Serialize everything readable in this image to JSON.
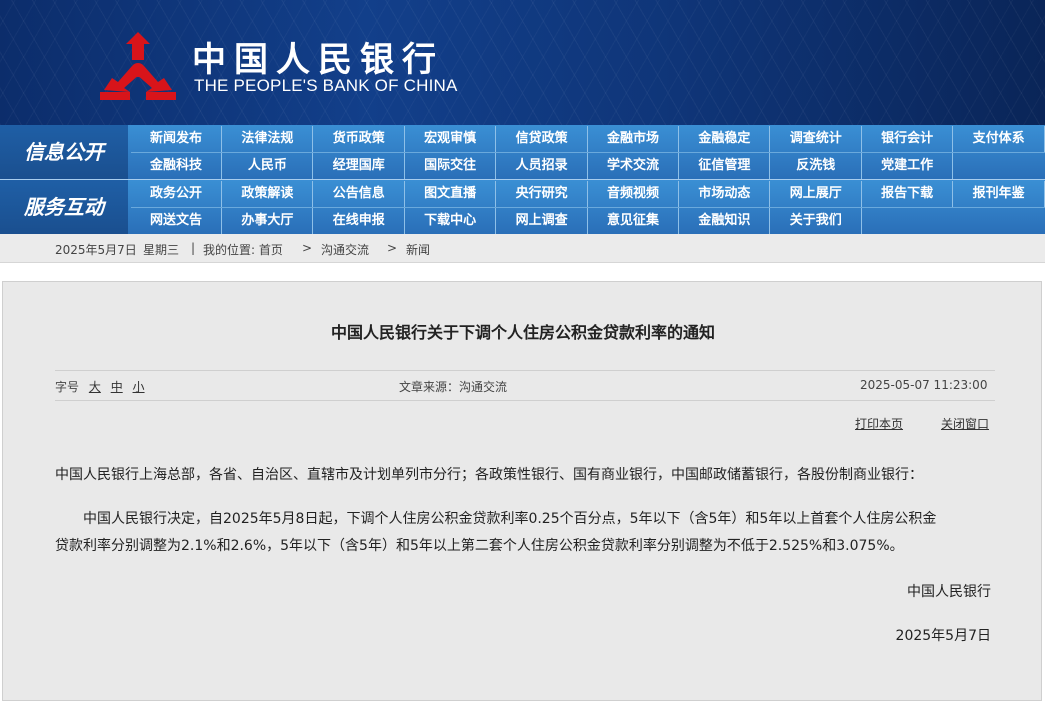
{
  "header": {
    "logo_cn": "中国人民银行",
    "logo_en": "THE PEOPLE'S BANK OF CHINA",
    "logo_icon": "pboc-emblem-icon",
    "brand_color": "#123f8a",
    "logo_red": "#d8141a"
  },
  "nav": {
    "section1_label": "信息公开",
    "section1_row1": [
      "新闻发布",
      "法律法规",
      "货币政策",
      "宏观审慎",
      "信贷政策",
      "金融市场",
      "金融稳定",
      "调查统计",
      "银行会计",
      "支付体系"
    ],
    "section1_row2": [
      "金融科技",
      "人民币",
      "经理国库",
      "国际交往",
      "人员招录",
      "学术交流",
      "征信管理",
      "反洗钱",
      "党建工作"
    ],
    "section2_label": "服务互动",
    "section2_row1": [
      "政务公开",
      "政策解读",
      "公告信息",
      "图文直播",
      "央行研究",
      "音频视频",
      "市场动态",
      "网上展厅",
      "报告下载",
      "报刊年鉴"
    ],
    "section2_row2": [
      "网送文告",
      "办事大厅",
      "在线申报",
      "下载中心",
      "网上调查",
      "意见征集",
      "金融知识",
      "关于我们"
    ]
  },
  "breadcrumb": {
    "date": "2025年5月7日",
    "weekday": "星期三",
    "sep": "|",
    "location_label": "我的位置: 首页",
    "arrow": ">",
    "level2": "沟通交流",
    "level3": "新闻"
  },
  "article": {
    "title": "中国人民银行关于下调个人住房公积金贷款利率的通知",
    "font_label": "字号",
    "font_large": "大",
    "font_medium": "中",
    "font_small": "小",
    "source": "文章来源：沟通交流",
    "timestamp": "2025-05-07 11:23:00",
    "print": "打印本页",
    "close": "关闭窗口",
    "salutation": "中国人民银行上海总部，各省、自治区、直辖市及计划单列市分行；各政策性银行、国有商业银行，中国邮政储蓄银行，各股份制商业银行：",
    "body_line1": "中国人民银行决定，自2025年5月8日起，下调个人住房公积金贷款利率0.25个百分点，5年以下（含5年）和5年以上首套个人住房公积金",
    "body_line2": "贷款利率分别调整为2.1%和2.6%，5年以下（含5年）和5年以上第二套个人住房公积金贷款利率分别调整为不低于2.525%和3.075%。",
    "signature": "中国人民银行",
    "sign_date": "2025年5月7日"
  }
}
